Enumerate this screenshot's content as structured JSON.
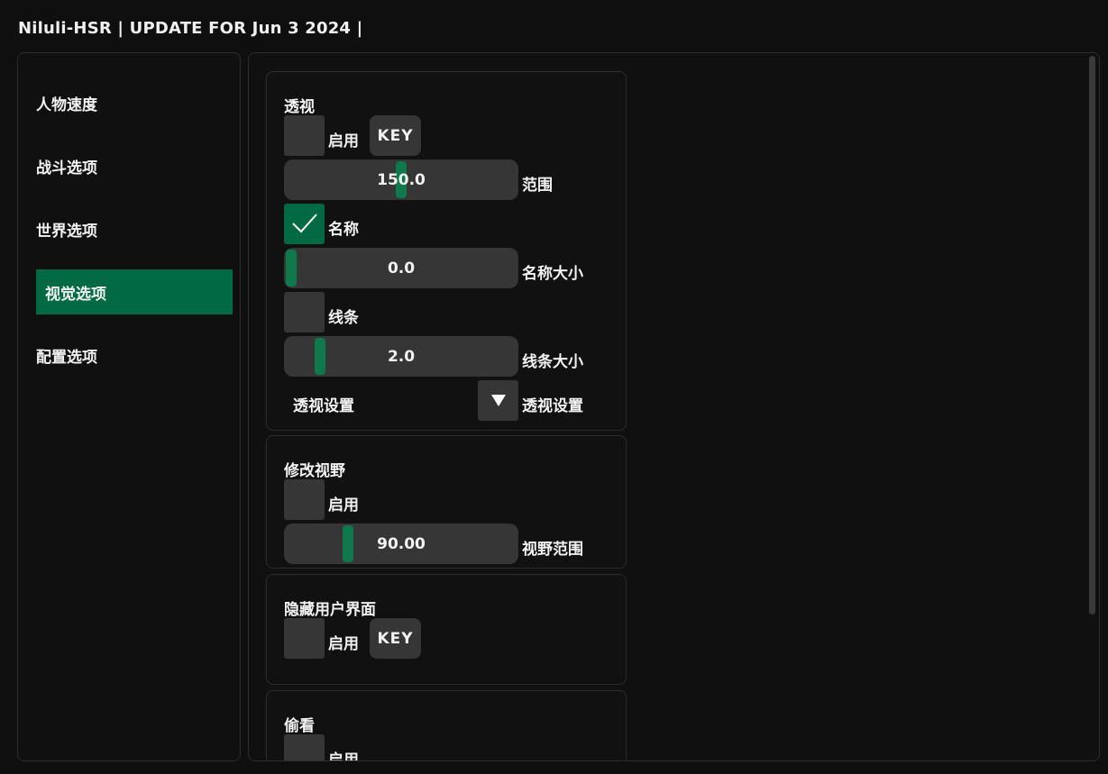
{
  "window": {
    "title": "Niluli-HSR | UPDATE FOR Jun  3 2024 |"
  },
  "sidebar": {
    "items": [
      {
        "label": "人物速度",
        "active": false
      },
      {
        "label": "战斗选项",
        "active": false
      },
      {
        "label": "世界选项",
        "active": false
      },
      {
        "label": "视觉选项",
        "active": true
      },
      {
        "label": "配置选项",
        "active": false
      }
    ]
  },
  "colors": {
    "accent": "#006a45",
    "grab": "#0e7a4c",
    "frame": "#363636",
    "background": "#0f0f0f"
  },
  "esp": {
    "title": "透视",
    "enable_label": "启用",
    "enable_checked": false,
    "key_label": "KEY",
    "range_value": "150.0",
    "range_fraction": 0.5,
    "range_label": "范围",
    "name_label": "名称",
    "name_checked": true,
    "name_size_value": "0.0",
    "name_size_fraction": 0.0,
    "name_size_label": "名称大小",
    "lines_label": "线条",
    "lines_checked": false,
    "line_size_value": "2.0",
    "line_size_fraction": 0.13,
    "line_size_label": "线条大小",
    "settings_combo_value": "透视设置",
    "settings_combo_label": "透视设置",
    "combo_arrow_icon": "triangle-down-icon"
  },
  "fov": {
    "title": "修改视野",
    "enable_label": "启用",
    "enable_checked": false,
    "fov_value": "90.00",
    "fov_fraction": 0.26,
    "fov_label": "视野范围"
  },
  "hide_ui": {
    "title": "隐藏用户界面",
    "enable_label": "启用",
    "enable_checked": false,
    "key_label": "KEY"
  },
  "peek": {
    "title": "偷看",
    "enable_label": "启用",
    "enable_checked": false
  }
}
